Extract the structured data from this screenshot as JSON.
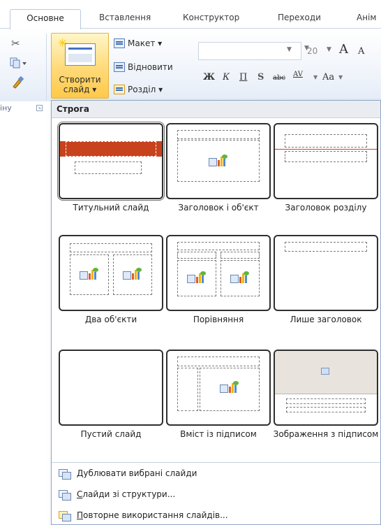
{
  "ribbon": {
    "tabs": [
      {
        "label": "Основне",
        "active": true
      },
      {
        "label": "Вставлення"
      },
      {
        "label": "Конструктор"
      },
      {
        "label": "Переходи"
      },
      {
        "label": "Анім"
      }
    ],
    "clipboard": {
      "group_label": "іну",
      "icons": [
        "cut-icon",
        "copy-icon",
        "format-painter-icon"
      ]
    },
    "slides_group": {
      "new_slide_line1": "Створити",
      "new_slide_line2": "слайд ▾",
      "layout_label": "Макет ▾",
      "reset_label": "Відновити",
      "section_label": "Розділ ▾"
    },
    "font_group": {
      "font_size": "20",
      "grow_font": "A",
      "shrink_font": "A",
      "bold": "Ж",
      "italic": "К",
      "underline": "П",
      "shadow": "S",
      "strikethrough": "abc",
      "spacing": "AV",
      "change_case": "Aa"
    }
  },
  "gallery": {
    "header": "Строга",
    "layouts": [
      {
        "label": "Титульний слайд",
        "selected": true
      },
      {
        "label": "Заголовок і об'єкт"
      },
      {
        "label": "Заголовок розділу"
      },
      {
        "label": "Два об'єкти"
      },
      {
        "label": "Порівняння"
      },
      {
        "label": "Лише заголовок"
      },
      {
        "label": "Пустий слайд"
      },
      {
        "label": "Вміст із підписом"
      },
      {
        "label": "Зображення з підписом"
      }
    ],
    "commands": [
      {
        "underline": "Д",
        "rest": "ублювати вибрані слайди",
        "icon": "duplicate-slides-icon"
      },
      {
        "underline": "С",
        "rest": "лайди зі структури...",
        "icon": "slides-from-outline-icon"
      },
      {
        "underline": "П",
        "rest": "овторне використання слайдів...",
        "icon": "reuse-slides-icon"
      }
    ]
  },
  "colors": {
    "accent_title": "#c8421d",
    "selected_button": "#ffd978",
    "gallery_border": "#8fa6c4"
  }
}
